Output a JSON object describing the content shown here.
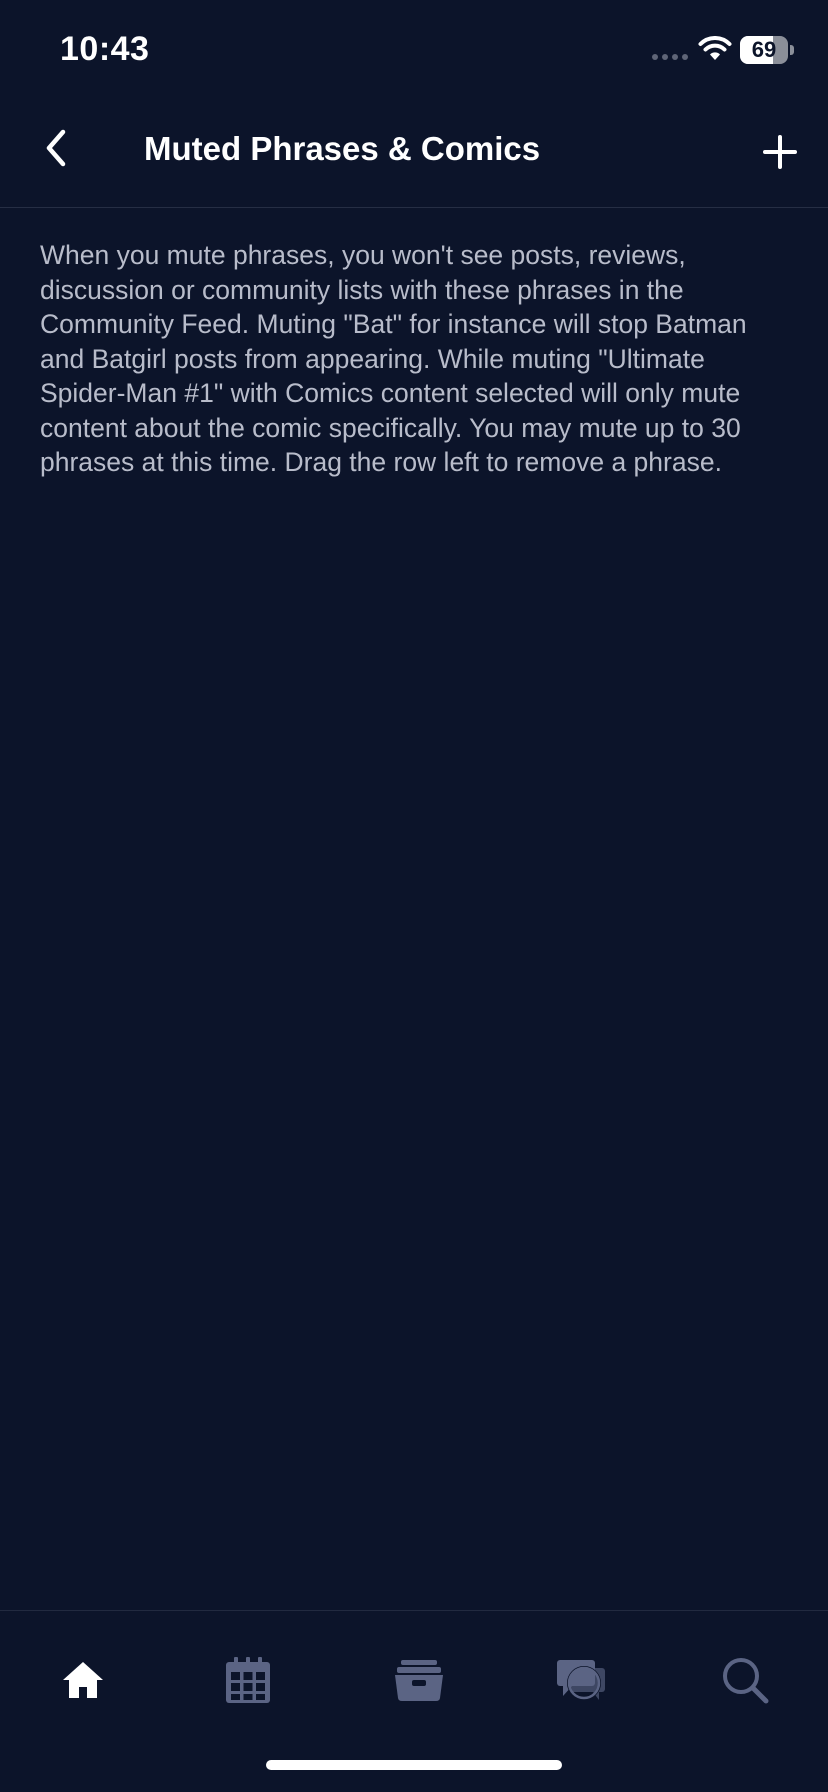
{
  "status_bar": {
    "time": "10:43",
    "battery_level": "69",
    "battery_fraction": 0.69,
    "icons": [
      "signal-dots-icon",
      "wifi-icon",
      "battery-icon"
    ]
  },
  "nav": {
    "title": "Muted Phrases & Comics",
    "back_icon": "chevron-left-icon",
    "add_icon": "plus-icon"
  },
  "description": "When you mute phrases, you won't see posts, reviews, discussion or community lists with these phrases in the Community Feed. Muting \"Bat\" for instance will stop Batman and Batgirl posts from appearing. While muting \"Ultimate Spider-Man #1\" with Comics content selected will only mute content about the comic specifically. You may mute up to 30 phrases at this time. Drag the row left to remove a phrase.",
  "tab_bar": {
    "items": [
      {
        "icon": "home-icon",
        "active": true
      },
      {
        "icon": "calendar-icon",
        "active": false
      },
      {
        "icon": "archive-box-icon",
        "active": false
      },
      {
        "icon": "chat-bubbles-icon",
        "active": false
      },
      {
        "icon": "search-icon",
        "active": false
      }
    ]
  },
  "colors": {
    "background": "#0c142a",
    "text_primary": "#ffffff",
    "text_secondary": "#b8bcca",
    "tab_inactive": "#5b6484",
    "divider": "#262e44"
  }
}
